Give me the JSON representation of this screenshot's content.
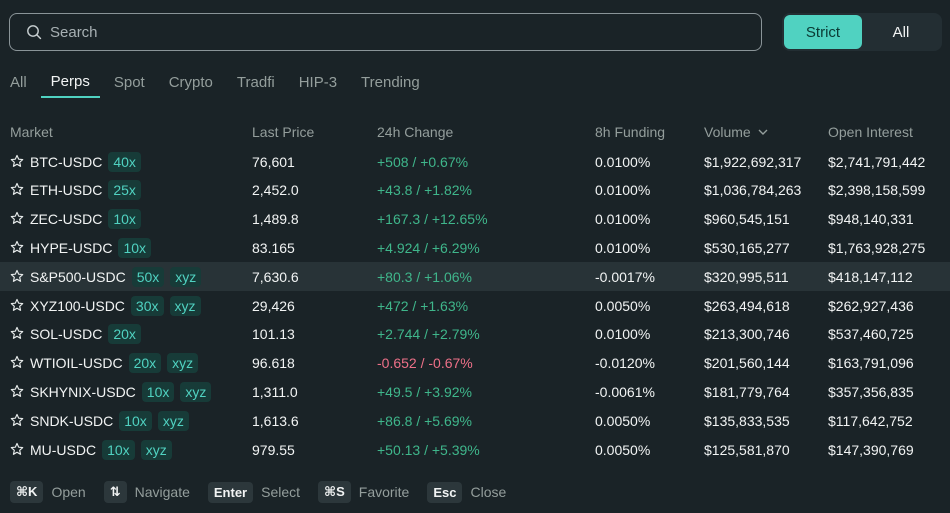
{
  "search": {
    "placeholder": "Search"
  },
  "toggle": {
    "strict": "Strict",
    "all": "All"
  },
  "tabs": [
    "All",
    "Perps",
    "Spot",
    "Crypto",
    "Tradfi",
    "HIP-3",
    "Trending"
  ],
  "active_tab": "Perps",
  "columns": {
    "market": "Market",
    "last_price": "Last Price",
    "change": "24h Change",
    "funding": "8h Funding",
    "volume": "Volume",
    "open_interest": "Open Interest"
  },
  "rows": [
    {
      "market": "BTC-USDC",
      "lev": "40x",
      "tag": "",
      "price": "76,601",
      "change": "+508 / +0.67%",
      "dir": "pos",
      "funding": "0.0100%",
      "volume": "$1,922,692,317",
      "oi": "$2,741,791,442"
    },
    {
      "market": "ETH-USDC",
      "lev": "25x",
      "tag": "",
      "price": "2,452.0",
      "change": "+43.8 / +1.82%",
      "dir": "pos",
      "funding": "0.0100%",
      "volume": "$1,036,784,263",
      "oi": "$2,398,158,599"
    },
    {
      "market": "ZEC-USDC",
      "lev": "10x",
      "tag": "",
      "price": "1,489.8",
      "change": "+167.3 / +12.65%",
      "dir": "pos",
      "funding": "0.0100%",
      "volume": "$960,545,151",
      "oi": "$948,140,331"
    },
    {
      "market": "HYPE-USDC",
      "lev": "10x",
      "tag": "",
      "price": "83.165",
      "change": "+4.924 / +6.29%",
      "dir": "pos",
      "funding": "0.0100%",
      "volume": "$530,165,277",
      "oi": "$1,763,928,275"
    },
    {
      "market": "S&P500-USDC",
      "lev": "50x",
      "tag": "xyz",
      "price": "7,630.6",
      "change": "+80.3 / +1.06%",
      "dir": "pos",
      "funding": "-0.0017%",
      "volume": "$320,995,511",
      "oi": "$418,147,112"
    },
    {
      "market": "XYZ100-USDC",
      "lev": "30x",
      "tag": "xyz",
      "price": "29,426",
      "change": "+472 / +1.63%",
      "dir": "pos",
      "funding": "0.0050%",
      "volume": "$263,494,618",
      "oi": "$262,927,436"
    },
    {
      "market": "SOL-USDC",
      "lev": "20x",
      "tag": "",
      "price": "101.13",
      "change": "+2.744 / +2.79%",
      "dir": "pos",
      "funding": "0.0100%",
      "volume": "$213,300,746",
      "oi": "$537,460,725"
    },
    {
      "market": "WTIOIL-USDC",
      "lev": "20x",
      "tag": "xyz",
      "price": "96.618",
      "change": "-0.652 / -0.67%",
      "dir": "neg",
      "funding": "-0.0120%",
      "volume": "$201,560,144",
      "oi": "$163,791,096"
    },
    {
      "market": "SKHYNIX-USDC",
      "lev": "10x",
      "tag": "xyz",
      "price": "1,311.0",
      "change": "+49.5 / +3.92%",
      "dir": "pos",
      "funding": "-0.0061%",
      "volume": "$181,779,764",
      "oi": "$357,356,835"
    },
    {
      "market": "SNDK-USDC",
      "lev": "10x",
      "tag": "xyz",
      "price": "1,613.6",
      "change": "+86.8 / +5.69%",
      "dir": "pos",
      "funding": "0.0050%",
      "volume": "$135,833,535",
      "oi": "$117,642,752"
    },
    {
      "market": "MU-USDC",
      "lev": "10x",
      "tag": "xyz",
      "price": "979.55",
      "change": "+50.13 / +5.39%",
      "dir": "pos",
      "funding": "0.0050%",
      "volume": "$125,581,870",
      "oi": "$147,390,769"
    }
  ],
  "highlighted_row": 4,
  "footer": [
    {
      "key": "⌘K",
      "label": "Open"
    },
    {
      "key": "⇅",
      "label": "Navigate"
    },
    {
      "key": "Enter",
      "label": "Select"
    },
    {
      "key": "⌘S",
      "label": "Favorite"
    },
    {
      "key": "Esc",
      "label": "Close"
    }
  ],
  "colors": {
    "accent": "#50d2c1",
    "positive": "#3fb68b",
    "negative": "#ed7088",
    "background": "#1a2327"
  },
  "icons": {
    "search": "search-icon",
    "star": "star-outline-icon",
    "sort": "chevron-down-icon"
  }
}
